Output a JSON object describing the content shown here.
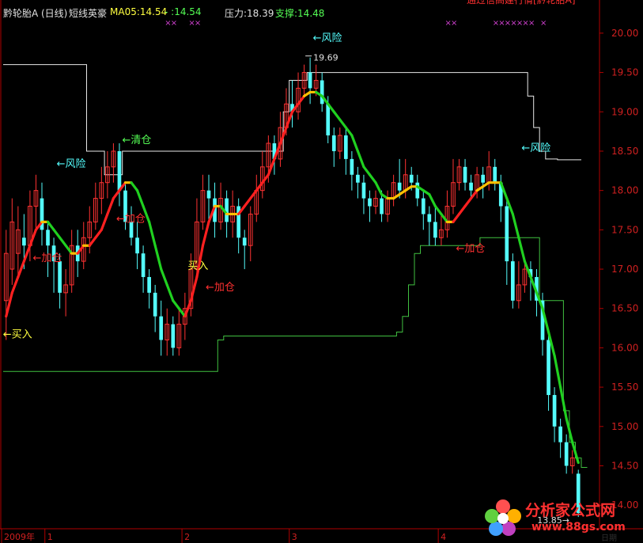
{
  "header": {
    "stock_name": "黔轮胎A",
    "period": "(日线)",
    "indicator": "短线英豪",
    "ma_label": "MA05:14.54",
    "ma_extra": "- :14.54",
    "pressure": "压力:18.39",
    "support": "支撑:14.48",
    "top_right_banner": "通过信高建行情[黔轮胎A]"
  },
  "colors": {
    "background": "#000000",
    "up_candle": "#ff3232",
    "down_candle": "#54fcfc",
    "ma_up": "#ff2020",
    "ma_mid": "#ffc000",
    "ma_down": "#20d020",
    "pressure_line": "#e8e8e8",
    "support_line": "#40c040",
    "axis": "#b00000"
  },
  "chart_data": {
    "type": "candlestick",
    "y_ticks": [
      "20.00",
      "19.50",
      "19.00",
      "18.50",
      "18.00",
      "17.50",
      "17.00",
      "16.50",
      "16.00",
      "15.50",
      "15.00",
      "14.50",
      "14.00"
    ],
    "ylim": [
      13.7,
      20.2
    ],
    "x_ticks": [
      "2009年",
      "1",
      "2",
      "3",
      "4"
    ],
    "max_label": "19.69",
    "min_label": "13.85",
    "candles": [
      [
        16.6,
        17.2,
        16.1,
        17.5
      ],
      [
        17.0,
        17.6,
        16.8,
        17.9
      ],
      [
        17.2,
        17.5,
        16.9,
        17.8
      ],
      [
        17.4,
        17.3,
        17.0,
        17.7
      ],
      [
        17.3,
        17.8,
        17.1,
        18.0
      ],
      [
        17.8,
        18.0,
        17.5,
        18.2
      ],
      [
        17.9,
        17.5,
        17.3,
        18.1
      ],
      [
        17.5,
        17.3,
        16.9,
        17.6
      ],
      [
        17.3,
        17.1,
        16.7,
        17.4
      ],
      [
        17.1,
        16.7,
        16.5,
        17.2
      ],
      [
        16.7,
        16.8,
        16.4,
        17.0
      ],
      [
        16.8,
        17.3,
        16.7,
        17.5
      ],
      [
        17.3,
        17.1,
        16.9,
        17.5
      ],
      [
        17.1,
        17.4,
        17.0,
        17.6
      ],
      [
        17.4,
        17.6,
        17.2,
        17.8
      ],
      [
        17.6,
        17.9,
        17.5,
        18.1
      ],
      [
        17.9,
        18.1,
        17.7,
        18.3
      ],
      [
        18.1,
        18.3,
        17.9,
        18.5
      ],
      [
        18.3,
        18.5,
        18.1,
        18.6
      ],
      [
        18.5,
        18.0,
        17.8,
        18.6
      ],
      [
        18.0,
        17.6,
        17.5,
        18.1
      ],
      [
        17.6,
        17.4,
        17.3,
        17.8
      ],
      [
        17.4,
        17.2,
        17.0,
        17.6
      ],
      [
        17.2,
        16.9,
        16.7,
        17.3
      ],
      [
        16.9,
        16.7,
        16.5,
        17.0
      ],
      [
        16.7,
        16.4,
        16.2,
        16.8
      ],
      [
        16.4,
        16.1,
        15.9,
        16.6
      ],
      [
        16.1,
        16.3,
        15.9,
        16.5
      ],
      [
        16.3,
        16.0,
        15.9,
        16.4
      ],
      [
        16.0,
        16.3,
        15.9,
        16.5
      ],
      [
        16.3,
        16.5,
        16.1,
        16.7
      ],
      [
        16.5,
        17.0,
        16.4,
        17.2
      ],
      [
        17.0,
        17.6,
        16.9,
        17.9
      ],
      [
        17.6,
        18.0,
        17.5,
        18.2
      ],
      [
        18.0,
        17.9,
        17.6,
        18.2
      ],
      [
        17.9,
        17.6,
        17.4,
        18.1
      ],
      [
        17.6,
        17.9,
        17.5,
        18.1
      ],
      [
        17.9,
        17.6,
        17.4,
        18.0
      ],
      [
        17.6,
        17.8,
        17.4,
        18.0
      ],
      [
        17.8,
        17.4,
        17.2,
        17.9
      ],
      [
        17.4,
        17.3,
        17.0,
        17.5
      ],
      [
        17.3,
        17.7,
        17.1,
        17.8
      ],
      [
        17.7,
        18.0,
        17.6,
        18.2
      ],
      [
        18.0,
        18.3,
        17.9,
        18.5
      ],
      [
        18.3,
        18.6,
        18.1,
        18.7
      ],
      [
        18.6,
        18.4,
        18.2,
        18.7
      ],
      [
        18.4,
        18.8,
        18.3,
        19.0
      ],
      [
        18.8,
        19.1,
        18.7,
        19.3
      ],
      [
        19.1,
        19.0,
        18.8,
        19.4
      ],
      [
        19.0,
        19.3,
        18.9,
        19.5
      ],
      [
        19.3,
        19.5,
        19.2,
        19.6
      ],
      [
        19.5,
        19.3,
        19.1,
        19.69
      ],
      [
        19.3,
        19.4,
        19.2,
        19.6
      ],
      [
        19.4,
        19.1,
        19.0,
        19.5
      ],
      [
        19.1,
        18.7,
        18.6,
        19.2
      ],
      [
        18.7,
        18.5,
        18.3,
        18.8
      ],
      [
        18.5,
        18.7,
        18.4,
        18.8
      ],
      [
        18.7,
        18.4,
        18.2,
        18.8
      ],
      [
        18.4,
        18.2,
        18.0,
        18.5
      ],
      [
        18.2,
        18.1,
        17.9,
        18.3
      ],
      [
        18.1,
        17.9,
        17.7,
        18.2
      ],
      [
        17.9,
        17.8,
        17.6,
        18.0
      ],
      [
        17.8,
        17.9,
        17.7,
        18.0
      ],
      [
        17.9,
        17.7,
        17.6,
        18.0
      ],
      [
        17.7,
        17.9,
        17.6,
        18.0
      ],
      [
        17.9,
        18.1,
        17.8,
        18.2
      ],
      [
        18.1,
        18.0,
        17.9,
        18.4
      ],
      [
        18.0,
        18.2,
        17.9,
        18.4
      ],
      [
        18.2,
        18.1,
        18.0,
        18.3
      ],
      [
        18.1,
        17.9,
        17.8,
        18.2
      ],
      [
        17.9,
        17.7,
        17.5,
        18.0
      ],
      [
        17.7,
        17.6,
        17.3,
        17.8
      ],
      [
        17.6,
        17.4,
        17.3,
        17.8
      ],
      [
        17.4,
        17.5,
        17.3,
        17.7
      ],
      [
        17.5,
        17.8,
        17.4,
        18.0
      ],
      [
        17.8,
        18.1,
        17.7,
        18.4
      ],
      [
        18.1,
        18.3,
        18.0,
        18.4
      ],
      [
        18.3,
        18.1,
        18.0,
        18.4
      ],
      [
        18.1,
        18.0,
        17.9,
        18.2
      ],
      [
        18.0,
        18.2,
        17.9,
        18.3
      ],
      [
        18.2,
        18.1,
        17.9,
        18.3
      ],
      [
        18.1,
        18.3,
        18.0,
        18.5
      ],
      [
        18.3,
        18.1,
        18.0,
        18.4
      ],
      [
        18.1,
        17.8,
        17.6,
        18.2
      ],
      [
        17.8,
        17.1,
        16.8,
        17.9
      ],
      [
        17.1,
        16.6,
        16.5,
        17.2
      ],
      [
        16.6,
        16.8,
        16.5,
        17.1
      ],
      [
        16.8,
        17.0,
        16.7,
        17.1
      ],
      [
        17.0,
        16.9,
        16.6,
        17.1
      ],
      [
        16.9,
        16.6,
        16.4,
        17.0
      ],
      [
        16.6,
        16.1,
        15.9,
        16.7
      ],
      [
        16.1,
        15.4,
        15.2,
        16.2
      ],
      [
        15.4,
        15.0,
        14.8,
        15.5
      ],
      [
        15.0,
        14.8,
        14.6,
        15.1
      ],
      [
        14.8,
        14.5,
        14.4,
        14.9
      ],
      [
        14.5,
        14.6,
        14.4,
        14.7
      ],
      [
        14.4,
        13.9,
        13.85,
        14.45
      ]
    ],
    "ma_line": [
      16.4,
      16.7,
      16.9,
      17.1,
      17.3,
      17.5,
      17.6,
      17.6,
      17.5,
      17.4,
      17.3,
      17.2,
      17.2,
      17.3,
      17.3,
      17.4,
      17.5,
      17.7,
      17.9,
      18.0,
      18.1,
      18.1,
      18.0,
      17.8,
      17.6,
      17.3,
      17.0,
      16.8,
      16.6,
      16.5,
      16.4,
      16.6,
      16.9,
      17.3,
      17.6,
      17.8,
      17.8,
      17.7,
      17.7,
      17.7,
      17.8,
      17.9,
      18.0,
      18.1,
      18.2,
      18.4,
      18.6,
      18.8,
      19.0,
      19.1,
      19.2,
      19.25,
      19.25,
      19.2,
      19.1,
      19.0,
      18.9,
      18.8,
      18.7,
      18.5,
      18.3,
      18.2,
      18.1,
      17.95,
      17.9,
      17.9,
      17.95,
      18.0,
      18.05,
      18.05,
      18.0,
      17.95,
      17.8,
      17.7,
      17.6,
      17.6,
      17.7,
      17.8,
      17.9,
      18.0,
      18.05,
      18.1,
      18.1,
      18.1,
      17.9,
      17.7,
      17.4,
      17.1,
      16.9,
      16.7,
      16.5,
      16.2,
      15.9,
      15.5,
      15.1,
      14.8,
      14.54
    ],
    "pressure_line": [
      19.6,
      19.6,
      19.6,
      19.6,
      19.6,
      19.6,
      19.6,
      19.6,
      19.6,
      19.6,
      19.6,
      19.6,
      19.6,
      19.6,
      18.5,
      18.5,
      18.5,
      18.2,
      18.2,
      18.2,
      18.5,
      18.5,
      18.5,
      18.5,
      18.5,
      18.5,
      18.5,
      18.5,
      18.5,
      18.5,
      18.5,
      18.5,
      18.5,
      18.5,
      18.5,
      18.5,
      18.5,
      18.5,
      18.5,
      18.5,
      18.5,
      18.5,
      18.5,
      18.5,
      18.5,
      18.5,
      18.5,
      19.0,
      19.4,
      19.4,
      19.4,
      19.5,
      19.5,
      19.5,
      19.5,
      19.5,
      19.5,
      19.5,
      19.5,
      19.5,
      19.5,
      19.5,
      19.5,
      19.5,
      19.5,
      19.5,
      19.5,
      19.5,
      19.5,
      19.5,
      19.5,
      19.5,
      19.5,
      19.5,
      19.5,
      19.5,
      19.5,
      19.5,
      19.5,
      19.5,
      19.5,
      19.5,
      19.5,
      19.5,
      19.5,
      19.5,
      19.5,
      19.5,
      19.2,
      18.8,
      18.5,
      18.4,
      18.4,
      18.39,
      18.39,
      18.39,
      18.39
    ],
    "support_line": [
      15.7,
      15.7,
      15.7,
      15.7,
      15.7,
      15.7,
      15.7,
      15.7,
      15.7,
      15.7,
      15.7,
      15.7,
      15.7,
      15.7,
      15.7,
      15.7,
      15.7,
      15.7,
      15.7,
      15.7,
      15.7,
      15.7,
      15.7,
      15.7,
      15.7,
      15.7,
      15.7,
      15.7,
      15.7,
      15.7,
      15.7,
      15.7,
      15.7,
      15.7,
      15.7,
      15.7,
      16.1,
      16.15,
      16.15,
      16.15,
      16.15,
      16.15,
      16.15,
      16.15,
      16.15,
      16.15,
      16.15,
      16.15,
      16.15,
      16.15,
      16.15,
      16.15,
      16.15,
      16.15,
      16.15,
      16.15,
      16.15,
      16.15,
      16.15,
      16.15,
      16.15,
      16.15,
      16.15,
      16.15,
      16.15,
      16.15,
      16.2,
      16.4,
      16.8,
      17.2,
      17.3,
      17.3,
      17.3,
      17.3,
      17.3,
      17.3,
      17.3,
      17.3,
      17.3,
      17.3,
      17.4,
      17.4,
      17.4,
      17.4,
      17.4,
      17.4,
      17.4,
      17.4,
      17.4,
      17.4,
      16.6,
      16.6,
      16.6,
      16.6,
      15.2,
      14.8,
      14.6,
      14.48
    ],
    "annotations": [
      {
        "text": "←买入",
        "color": "#ffff40",
        "x": 0,
        "y": 16.18
      },
      {
        "text": "←加仓",
        "color": "#ff3030",
        "x": 5,
        "y": 17.15
      },
      {
        "text": "←风险",
        "color": "#54fcfc",
        "x": 9,
        "y": 18.35
      },
      {
        "text": "←清仓",
        "color": "#54fc54",
        "x": 20,
        "y": 18.65
      },
      {
        "text": "←加仓",
        "color": "#ff3030",
        "x": 19,
        "y": 17.65
      },
      {
        "text": "买入",
        "color": "#ffff40",
        "x": 31,
        "y": 17.05
      },
      {
        "text": "←加仓",
        "color": "#ff3030",
        "x": 34,
        "y": 16.78
      },
      {
        "text": "←风险",
        "color": "#54fcfc",
        "x": 52,
        "y": 19.95
      },
      {
        "text": "←加仓",
        "color": "#ff3030",
        "x": 76,
        "y": 17.27
      },
      {
        "text": "←风险",
        "color": "#54fcfc",
        "x": 87,
        "y": 18.55
      }
    ],
    "x_marks": [
      27,
      28,
      31,
      32,
      74,
      75,
      82,
      83,
      84,
      85,
      86,
      87,
      88,
      90
    ],
    "x_tick_index": [
      0,
      7,
      30,
      48,
      73
    ]
  },
  "watermark": {
    "brand": "分析家公式网",
    "url": "www.88gs.com"
  },
  "bottom_label": "日期"
}
